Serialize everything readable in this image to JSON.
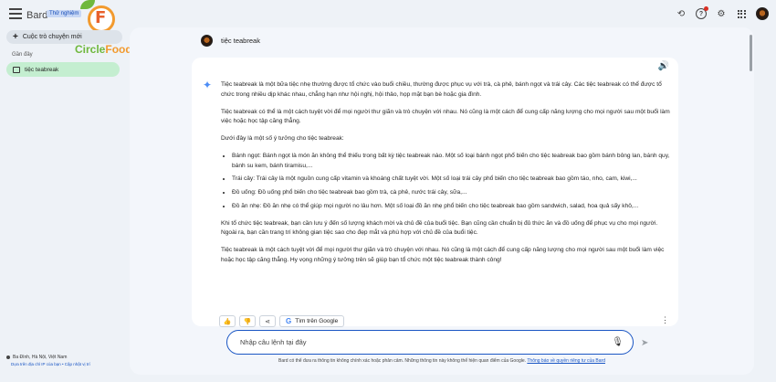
{
  "header": {
    "brand": "Bard",
    "badge": "Thử nghiệm",
    "icons": [
      "history-icon",
      "help-icon",
      "settings-icon",
      "apps-icon",
      "avatar"
    ]
  },
  "logo": {
    "part1": "Circle",
    "part2": "Food",
    "letter": "F"
  },
  "sidebar": {
    "new_chat": "Cuộc trò chuyện mới",
    "recent_label": "Gần đây",
    "items": [
      {
        "label": "tiệc teabreak"
      }
    ],
    "location": "Ba Đình, Hà Nội, Việt Nam",
    "location_sub": "Dựa trên địa chỉ IP của bạn • Cập nhật vị trí"
  },
  "conversation": {
    "query": "tiệc teabreak",
    "response": {
      "p1": "Tiệc teabreak là một bữa tiệc nhẹ thường được tổ chức vào buổi chiều, thường được phục vụ với trà, cà phê, bánh ngọt và trái cây. Các tiệc teabreak có thể được tổ chức trong nhiều dịp khác nhau, chẳng hạn như hội nghị, hội thảo, họp mặt bạn bè hoặc gia đình.",
      "p2": "Tiệc teabreak có thể là một cách tuyệt vời để mọi người thư giãn và trò chuyện với nhau. Nó cũng là một cách để cung cấp năng lượng cho mọi người sau một buổi làm việc hoặc học tập căng thẳng.",
      "p3": "Dưới đây là một số ý tưởng cho tiệc teabreak:",
      "bullets": [
        "Bánh ngọt: Bánh ngọt là món ăn không thể thiếu trong bất kỳ tiệc teabreak nào. Một số loại bánh ngọt phổ biến cho tiệc teabreak bao gồm bánh bông lan, bánh quy, bánh su kem, bánh tiramisu,...",
        "Trái cây: Trái cây là một nguồn cung cấp vitamin và khoáng chất tuyệt vời. Một số loại trái cây phổ biến cho tiệc teabreak bao gồm táo, nho, cam, kiwi,...",
        "Đồ uống: Đồ uống phổ biến cho tiệc teabreak bao gồm trà, cà phê, nước trái cây, sữa,...",
        "Đồ ăn nhẹ: Đồ ăn nhẹ có thể giúp mọi người no lâu hơn. Một số loại đồ ăn nhẹ phổ biến cho tiệc teabreak bao gồm sandwich, salad, hoa quả sấy khô,..."
      ],
      "p4": "Khi tổ chức tiệc teabreak, bạn cần lưu ý đến số lượng khách mời và chủ đề của buổi tiệc. Bạn cũng cần chuẩn bị đủ thức ăn và đồ uống để phục vụ cho mọi người. Ngoài ra, bạn cần trang trí không gian tiệc sao cho đẹp mắt và phù hợp với chủ đề của buổi tiệc.",
      "p5": "Tiệc teabreak là một cách tuyệt vời để mọi người thư giãn và trò chuyện với nhau. Nó cũng là một cách để cung cấp năng lượng cho mọi người sau một buổi làm việc hoặc học tập căng thẳng. Hy vọng những ý tưởng trên sẽ giúp bạn tổ chức một tiệc teabreak thành công!"
    },
    "google_button": "Tìm trên Google"
  },
  "input": {
    "placeholder": "Nhập câu lệnh tại đây"
  },
  "footer": {
    "disclaimer": "Bard có thể đưa ra thông tin không chính xác hoặc phản cảm. Những thông tin này không thể hiện quan điểm của Google.",
    "link": "Thông báo về quyền riêng tư của Bard"
  }
}
